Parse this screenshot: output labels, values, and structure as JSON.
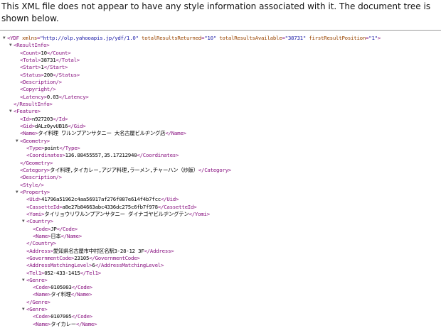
{
  "banner": {
    "message": "This XML file does not appear to have any style information associated with it. The document tree is shown below."
  },
  "icons": {
    "expanded": "▼"
  },
  "xml": [
    {
      "d": 0,
      "k": "open",
      "tog": true,
      "tag": "YDF",
      "attrs": [
        {
          "n": "xmlns",
          "v": "\"http://olp.yahooapis.jp/ydf/1.0\""
        },
        {
          "n": "totalResultsReturned",
          "v": "\"10\""
        },
        {
          "n": "totalResultsAvailable",
          "v": "\"38731\""
        },
        {
          "n": "firstResultPosition",
          "v": "\"1\""
        }
      ]
    },
    {
      "d": 1,
      "k": "open",
      "tog": true,
      "tag": "ResultInfo"
    },
    {
      "d": 2,
      "k": "leaf",
      "tag": "Count",
      "text": "10"
    },
    {
      "d": 2,
      "k": "leaf",
      "tag": "Total",
      "text": "38731"
    },
    {
      "d": 2,
      "k": "leaf",
      "tag": "Start",
      "text": "1"
    },
    {
      "d": 2,
      "k": "leaf",
      "tag": "Status",
      "text": "200"
    },
    {
      "d": 2,
      "k": "empty",
      "tag": "Description"
    },
    {
      "d": 2,
      "k": "empty",
      "tag": "Copyright"
    },
    {
      "d": 2,
      "k": "leaf",
      "tag": "Latency",
      "text": "0.03"
    },
    {
      "d": 1,
      "k": "close",
      "tag": "ResultInfo"
    },
    {
      "d": 1,
      "k": "open",
      "tog": true,
      "tag": "Feature"
    },
    {
      "d": 2,
      "k": "leaf",
      "tag": "Id",
      "text": "n927203"
    },
    {
      "d": 2,
      "k": "leaf",
      "tag": "Gid",
      "text": "dALz0yvUB16"
    },
    {
      "d": 2,
      "k": "leaf",
      "tag": "Name",
      "text": "タイ料理 ワルンプアンサタニー 大名古屋ビルヂング店"
    },
    {
      "d": 2,
      "k": "open",
      "tog": true,
      "tag": "Geometry"
    },
    {
      "d": 3,
      "k": "leaf",
      "tag": "Type",
      "text": "point"
    },
    {
      "d": 3,
      "k": "leaf",
      "tag": "Coordinates",
      "text": "136.88455557,35.17212940"
    },
    {
      "d": 2,
      "k": "close",
      "tag": "Geometry"
    },
    {
      "d": 2,
      "k": "leaf",
      "tag": "Category",
      "text": "タイ料理,タイカレー,アジア料理,ラーメン,チャーハン（炒飯）"
    },
    {
      "d": 2,
      "k": "empty",
      "tag": "Description"
    },
    {
      "d": 2,
      "k": "empty",
      "tag": "Style"
    },
    {
      "d": 2,
      "k": "open",
      "tog": true,
      "tag": "Property"
    },
    {
      "d": 3,
      "k": "leaf",
      "tag": "Uid",
      "text": "41796a51962c4aa56917af276f087e614f4b7fcc"
    },
    {
      "d": 3,
      "k": "leaf",
      "tag": "CassetteId",
      "text": "a8e27b84663abc4336dc275c6fb7f978"
    },
    {
      "d": 3,
      "k": "leaf",
      "tag": "Yomi",
      "text": "タイリョウリワルンプアンサタニー ダイナゴヤビルヂングテン"
    },
    {
      "d": 3,
      "k": "open",
      "tog": true,
      "tag": "Country"
    },
    {
      "d": 4,
      "k": "leaf",
      "tag": "Code",
      "text": "JP"
    },
    {
      "d": 4,
      "k": "leaf",
      "tag": "Name",
      "text": "日本"
    },
    {
      "d": 3,
      "k": "close",
      "tag": "Country"
    },
    {
      "d": 3,
      "k": "leaf",
      "tag": "Address",
      "text": "愛知県名古屋市中村区名駅3-28-12 3F"
    },
    {
      "d": 3,
      "k": "leaf",
      "tag": "GovernmentCode",
      "text": "23105"
    },
    {
      "d": 3,
      "k": "leaf",
      "tag": "AddressMatchingLevel",
      "text": "6"
    },
    {
      "d": 3,
      "k": "leaf",
      "tag": "Tel1",
      "text": "052-433-1415"
    },
    {
      "d": 3,
      "k": "open",
      "tog": true,
      "tag": "Genre"
    },
    {
      "d": 4,
      "k": "leaf",
      "tag": "Code",
      "text": "0105003"
    },
    {
      "d": 4,
      "k": "leaf",
      "tag": "Name",
      "text": "タイ料理"
    },
    {
      "d": 3,
      "k": "close",
      "tag": "Genre"
    },
    {
      "d": 3,
      "k": "open",
      "tog": true,
      "tag": "Genre"
    },
    {
      "d": 4,
      "k": "leaf",
      "tag": "Code",
      "text": "0107005"
    },
    {
      "d": 4,
      "k": "leaf",
      "tag": "Name",
      "text": "タイカレー"
    }
  ]
}
